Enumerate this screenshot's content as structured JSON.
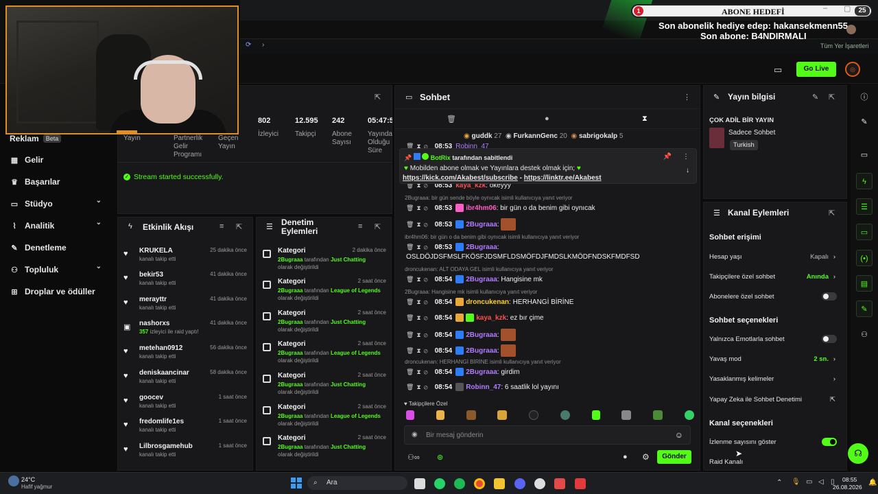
{
  "overlay": {
    "goal_label": "ABONE HEDEFİ",
    "goal_current": "1",
    "goal_target": "25",
    "last_gift": "Son abonelik hediye edep: hakansekmenn55",
    "last_sub": "Son abone: B4NDIRMALI"
  },
  "browser": {
    "bookmarks_label": "Tüm Yer İşaretleri"
  },
  "header": {
    "golive_label": "Go Live"
  },
  "sidebar": {
    "items": [
      {
        "label": "Reklam",
        "badge": "Beta"
      },
      {
        "label": "Gelir"
      },
      {
        "label": "Başarılar"
      },
      {
        "label": "Stüdyo"
      },
      {
        "label": "Analitik"
      },
      {
        "label": "Denetleme"
      },
      {
        "label": "Topluluk"
      },
      {
        "label": "Droplar ve ödüller"
      }
    ]
  },
  "stats": {
    "partner_label": "Partnerlik Gelir Programı",
    "items": [
      {
        "value": "802",
        "label": "İzleyici"
      },
      {
        "value": "12.595",
        "label": "Takipçi"
      },
      {
        "value": "242",
        "label": "Abone Sayısı"
      },
      {
        "value": "05:47:54",
        "label": "Yayında Olduğu Süre"
      }
    ],
    "yayin_label": "Yayın",
    "gecen_label": "Geçen Yayın",
    "notice": "Stream started successfully."
  },
  "activity": {
    "title": "Etkinlik Akışı",
    "items": [
      {
        "name": "KRUKELA",
        "sub": "kanalı takip etti",
        "time": "25 dakika önce"
      },
      {
        "name": "bekir53",
        "sub": "kanalı takip etti",
        "time": "41 dakika önce"
      },
      {
        "name": "merayttr",
        "sub": "kanalı takip etti",
        "time": "41 dakika önce"
      },
      {
        "name": "nashorxs",
        "sub_count": "357",
        "sub": "izleyici ile raid yaptı!",
        "time": "41 dakika önce"
      },
      {
        "name": "metehan0912",
        "sub": "kanalı takip etti",
        "time": "56 dakika önce"
      },
      {
        "name": "deniskaancinar",
        "sub": "kanalı takip etti",
        "time": "58 dakika önce"
      },
      {
        "name": "goocev",
        "sub": "kanalı takip etti",
        "time": "1 saat önce"
      },
      {
        "name": "fredomlife1es",
        "sub": "kanalı takip etti",
        "time": "1 saat önce"
      },
      {
        "name": "Lilbrosgamehub",
        "sub": "kanalı takip etti",
        "time": "1 saat önce"
      }
    ]
  },
  "moderation": {
    "title": "Denetim Eylemleri",
    "items": [
      {
        "title": "Kategori",
        "user": "2Bugraaa",
        "mid": "tarafından",
        "category": "Just Chatting",
        "end": "olarak değiştirildi",
        "time": "2 dakika önce"
      },
      {
        "title": "Kategori",
        "user": "2Bugraaa",
        "mid": "tarafından",
        "category": "League of Legends",
        "end": "olarak değiştirildi",
        "time": "2 saat önce"
      },
      {
        "title": "Kategori",
        "user": "2Bugraaa",
        "mid": "tarafından",
        "category": "Just Chatting",
        "end": "olarak değiştirildi",
        "time": "2 saat önce"
      },
      {
        "title": "Kategori",
        "user": "2Bugraaa",
        "mid": "tarafından",
        "category": "League of Legends",
        "end": "olarak değiştirildi",
        "time": "2 saat önce"
      },
      {
        "title": "Kategori",
        "user": "2Bugraaa",
        "mid": "tarafından",
        "category": "Just Chatting",
        "end": "olarak değiştirildi",
        "time": "2 saat önce"
      },
      {
        "title": "Kategori",
        "user": "2Bugraaa",
        "mid": "tarafından",
        "category": "League of Legends",
        "end": "olarak değiştirildi",
        "time": "2 saat önce"
      },
      {
        "title": "Kategori",
        "user": "2Bugraaa",
        "mid": "tarafından",
        "category": "Just Chatting",
        "end": "olarak değiştirildi",
        "time": "2 saat önce"
      }
    ]
  },
  "chat": {
    "title": "Sohbet",
    "top_gifters": [
      {
        "name": "guddk",
        "count": "27"
      },
      {
        "name": "FurkannGenc",
        "count": "20"
      },
      {
        "name": "sabrigokalp",
        "count": "5"
      }
    ],
    "pinned": {
      "author": "BotRix",
      "by": "tarafından sabitlendi",
      "message": "Mobilden abone olmak ve Yayınlara destek olmak için;",
      "link1": "https://kick.com/Akabest/subscribe",
      "sep": "-",
      "link2": "https://linktr.ee/Akabest"
    },
    "hidden_user": "Robinn_47",
    "hidden_user2": "kaya_kzk",
    "hidden_msg2": "okeyyy",
    "replies": {
      "r1": "2Bugraaa: bir gün sende böyle oynıcak isimli kullanıcıya yanıt veriyor",
      "r2": "ibr4hm06: bir gün o da benim gibi oynıcak isimli kullanıcıya yanıt veriyor",
      "r3": "droncukenan: ALT ODAYA GEL isimli kullanıcıya yanıt veriyor",
      "r4": "2Bugraaa: Hangisine mk isimli kullanıcıya yanıt veriyor",
      "r5": "droncukenan: HERHANGİ BİRİNE isimli kullanıcıya yanıt veriyor"
    },
    "messages": [
      {
        "time": "08:53",
        "user": "ibr4hm06",
        "text": "bir gün o da benim gibi oynıcak"
      },
      {
        "time": "08:53",
        "user": "2Bugraaa",
        "text": ""
      },
      {
        "time": "08:53",
        "user": "2Bugraaa",
        "text": "OSLDÖJDSFMSLFKÖSFJDSMFLDSMÖFDJFMDSLKMÖDFNDSKFMDFSD"
      },
      {
        "time": "08:54",
        "user": "2Bugraaa",
        "text": "Hangisine mk"
      },
      {
        "time": "08:54",
        "user": "droncukenan",
        "text": "HERHANGİ BİRİNE"
      },
      {
        "time": "08:54",
        "user": "kaya_kzk",
        "text": "ez bır çime"
      },
      {
        "time": "08:54",
        "user": "2Bugraaa",
        "text": ""
      },
      {
        "time": "08:54",
        "user": "2Bugraaa",
        "text": ""
      },
      {
        "time": "08:54",
        "user": "2Bugraaa",
        "text": "girdim"
      },
      {
        "time": "08:54",
        "user": "Robinn_47",
        "text": "6 saatlik lol yayını"
      }
    ],
    "followers_only": "Takipçilere Özel",
    "input_placeholder": "Bir mesaj gönderin",
    "send_label": "Gönder"
  },
  "stream_info": {
    "title": "Yayın bilgisi",
    "stream_title": "ÇOK ADİL BİR YAYIN",
    "category": "Sadece Sohbet",
    "tag": "Turkish"
  },
  "channel_actions": {
    "title": "Kanal Eylemleri",
    "chat_access": "Sohbet erişimi",
    "account_age": {
      "label": "Hesap yaşı",
      "value": "Kapalı"
    },
    "followers_only": {
      "label": "Takipçilere özel sohbet",
      "value": "Anında"
    },
    "subs_only": {
      "label": "Abonelere özel sohbet",
      "on": false
    },
    "chat_options": "Sohbet seçenekleri",
    "emotes_only": {
      "label": "Yalnızca Emotlarla sohbet",
      "on": false
    },
    "slow_mode": {
      "label": "Yavaş mod",
      "value": "2 sn."
    },
    "banned_words": {
      "label": "Yasaklanmış kelimeler"
    },
    "ai_mod": {
      "label": "Yapay Zeka ile Sohbet Denetimi"
    },
    "channel_options": "Kanal seçenekleri",
    "view_count": {
      "label": "İzlenme sayısını göster",
      "on": true
    },
    "raid": {
      "label": "Raid Kanalı"
    }
  },
  "taskbar": {
    "weather_temp": "24°C",
    "weather_desc": "Hafif yağmur",
    "search_label": "Ara",
    "time": "08:55",
    "date": "26.08.2026"
  },
  "colors": {
    "accent": "#53fc18",
    "panel": "#18181a",
    "background": "#0b0b0c"
  }
}
